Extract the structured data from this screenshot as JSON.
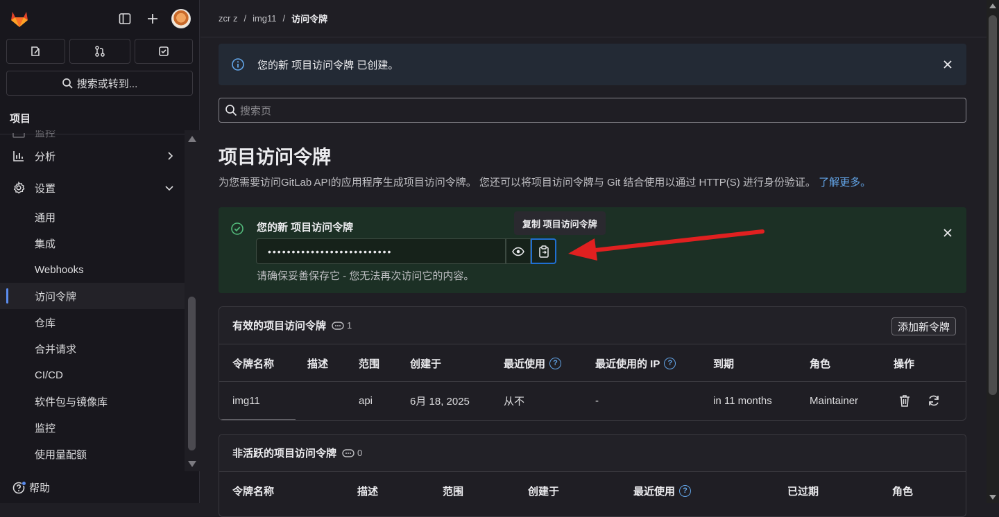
{
  "sidebar": {
    "search_label": "搜索或转到...",
    "section_title": "项目",
    "items": [
      {
        "label": "监控",
        "faded": true
      },
      {
        "label": "分析",
        "icon": "chart-icon"
      },
      {
        "label": "设置",
        "icon": "gear-icon"
      },
      {
        "label": "通用"
      },
      {
        "label": "集成"
      },
      {
        "label": "Webhooks"
      },
      {
        "label": "访问令牌",
        "active": true
      },
      {
        "label": "仓库"
      },
      {
        "label": "合并请求"
      },
      {
        "label": "CI/CD"
      },
      {
        "label": "软件包与镜像库"
      },
      {
        "label": "监控"
      },
      {
        "label": "使用量配额"
      }
    ],
    "help_label": "帮助"
  },
  "breadcrumb": {
    "user": "zcr z",
    "project": "img11",
    "current": "访问令牌"
  },
  "info_alert": {
    "text": "您的新 项目访问令牌 已创建。"
  },
  "search": {
    "placeholder": "搜索页"
  },
  "page": {
    "title": "项目访问令牌",
    "description": "为您需要访问GitLab API的应用程序生成项目访问令牌。 您还可以将项目访问令牌与 Git 结合使用以通过 HTTP(S) 进行身份验证。",
    "learn_more": "了解更多。"
  },
  "new_token": {
    "title": "您的新 项目访问令牌",
    "masked_value": "••••••••••••••••••••••••••",
    "note": "请确保妥善保存它 - 您无法再次访问它的内容。",
    "tooltip": "复制 项目访问令牌"
  },
  "active_tokens": {
    "title": "有效的项目访问令牌",
    "count": "1",
    "add_button": "添加新令牌",
    "headers": [
      "令牌名称",
      "描述",
      "范围",
      "创建于",
      "最近使用",
      "最近使用的 IP",
      "到期",
      "角色",
      "操作"
    ],
    "rows": [
      {
        "name": "img11",
        "description": "",
        "scope": "api",
        "created": "6月 18, 2025",
        "last_used": "从不",
        "last_ip": "-",
        "expires": "in 11 months",
        "role": "Maintainer"
      }
    ]
  },
  "inactive_tokens": {
    "title": "非活跃的项目访问令牌",
    "count": "0",
    "headers": [
      "令牌名称",
      "描述",
      "范围",
      "创建于",
      "最近使用",
      "已过期",
      "角色"
    ]
  }
}
